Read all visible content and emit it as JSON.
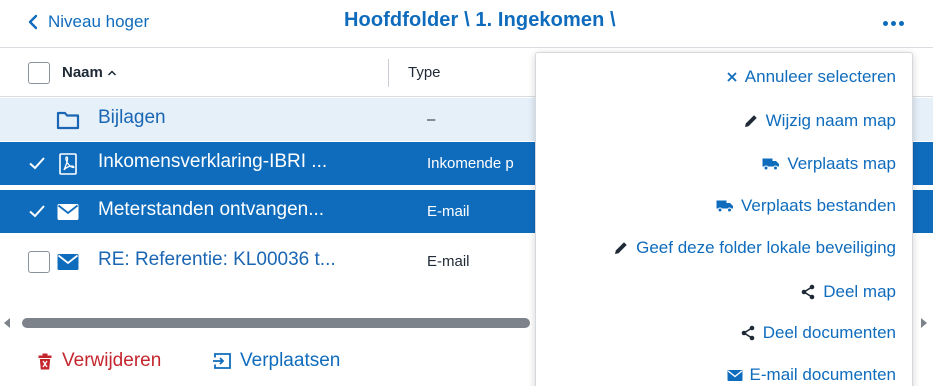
{
  "nav": {
    "back_label": "Niveau hoger",
    "title": "Hoofdfolder \\ 1. Ingekomen \\",
    "more_icon": "more-horizontal-icon"
  },
  "columns": {
    "name": "Naam",
    "type": "Type"
  },
  "rows": [
    {
      "name": "Bijlagen",
      "type": "–",
      "icon": "folder-icon",
      "selected": false
    },
    {
      "name": "Inkomensverklaring-IBRI ...",
      "type": "Inkomende p",
      "icon": "pdf-icon",
      "selected": true
    },
    {
      "name": "Meterstanden ontvangen...",
      "type": "E-mail",
      "icon": "mail-icon",
      "selected": true
    },
    {
      "name": "RE: Referentie: KL00036 t...",
      "type": "E-mail",
      "icon": "mail-icon",
      "selected": false
    }
  ],
  "footer": {
    "delete_label": "Verwijderen",
    "move_label": "Verplaatsen"
  },
  "menu": {
    "items": [
      {
        "label": "Annuleer selecteren",
        "icon": "close-icon"
      },
      {
        "label": "Wijzig naam map",
        "icon": "pencil-icon"
      },
      {
        "label": "Verplaats map",
        "icon": "truck-icon"
      },
      {
        "label": "Verplaats bestanden",
        "icon": "truck-icon"
      },
      {
        "label": "Geef deze folder lokale beveiliging",
        "icon": "pencil-icon"
      },
      {
        "label": "Deel map",
        "icon": "share-icon"
      },
      {
        "label": "Deel documenten",
        "icon": "share-icon"
      },
      {
        "label": "E-mail documenten",
        "icon": "mail-icon"
      }
    ]
  },
  "colors": {
    "accent": "#0f6cbd",
    "danger": "#c4262e",
    "selected_row": "#0f6cbd",
    "hover_row": "#e6f0f9"
  }
}
